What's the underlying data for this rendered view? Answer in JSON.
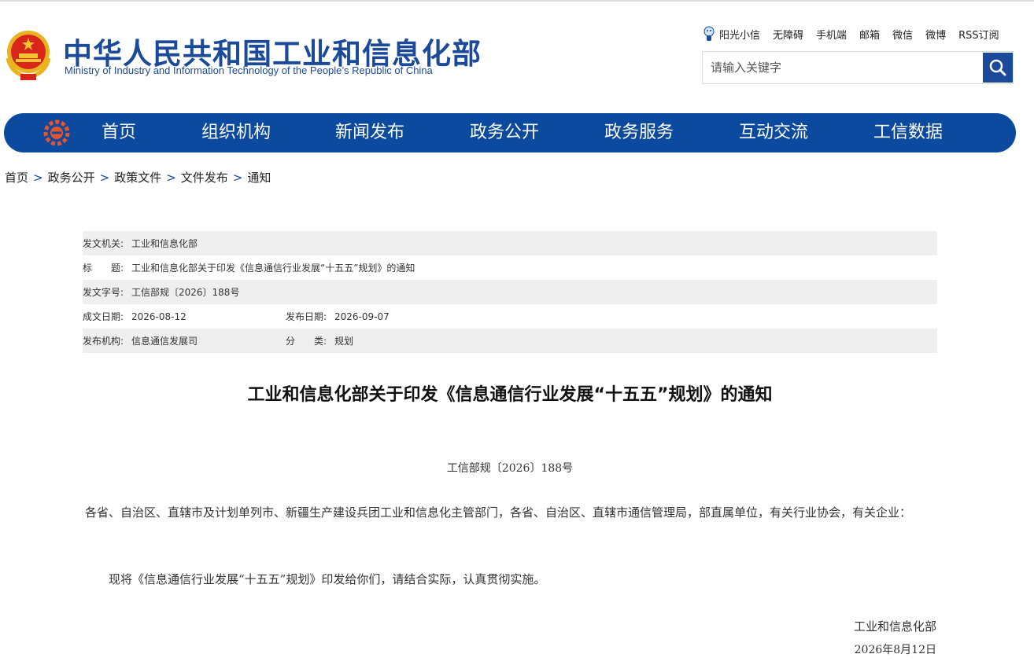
{
  "header": {
    "title_cn": "中华人民共和国工业和信息化部",
    "title_en": "Ministry of Industry and Information Technology of the People’s Republic of China",
    "brand_color": "#1b4a9b"
  },
  "toplinks": [
    "阳光小信",
    "无障碍",
    "手机端",
    "邮箱",
    "微信",
    "微博",
    "RSS订阅"
  ],
  "search": {
    "placeholder": "请输入关键字",
    "icon": "search-icon"
  },
  "nav": {
    "color": "#0b4a9e",
    "items": [
      "首页",
      "组织机构",
      "新闻发布",
      "政务公开",
      "政务服务",
      "互动交流",
      "工信数据"
    ]
  },
  "breadcrumb": [
    "首页",
    "政务公开",
    "政策文件",
    "文件发布",
    "通知"
  ],
  "breadcrumb_sep": ">",
  "info": {
    "issuer_label": "发文机关:",
    "issuer": "工业和信息化部",
    "title_label": "标　　题:",
    "title": "工业和信息化部关于印发《信息通信行业发展“十五五”规划》的通知",
    "doc_no_label": "发文字号:",
    "doc_no": "工信部规〔2026〕188号",
    "created_label": "成文日期:",
    "created": "2026-08-12",
    "published_label": "发布日期:",
    "published": "2026-09-07",
    "agency_label": "发布机构:",
    "agency": "信息通信发展司",
    "category_label": "分　　类:",
    "category": "规划"
  },
  "document": {
    "title": "工业和信息化部关于印发《信息通信行业发展“十五五”规划》的通知",
    "number": "工信部规〔2026〕188号",
    "addressee": "各省、自治区、直辖市及计划单列市、新疆生产建设兵团工业和信息化主管部门，各省、自治区、直辖市通信管理局，部直属单位，有关行业协会，有关企业：",
    "body": "现将《信息通信行业发展“十五五”规划》印发给你们，请结合实际，认真贯彻实施。",
    "signer": "工业和信息化部",
    "date": "2026年8月12日"
  }
}
